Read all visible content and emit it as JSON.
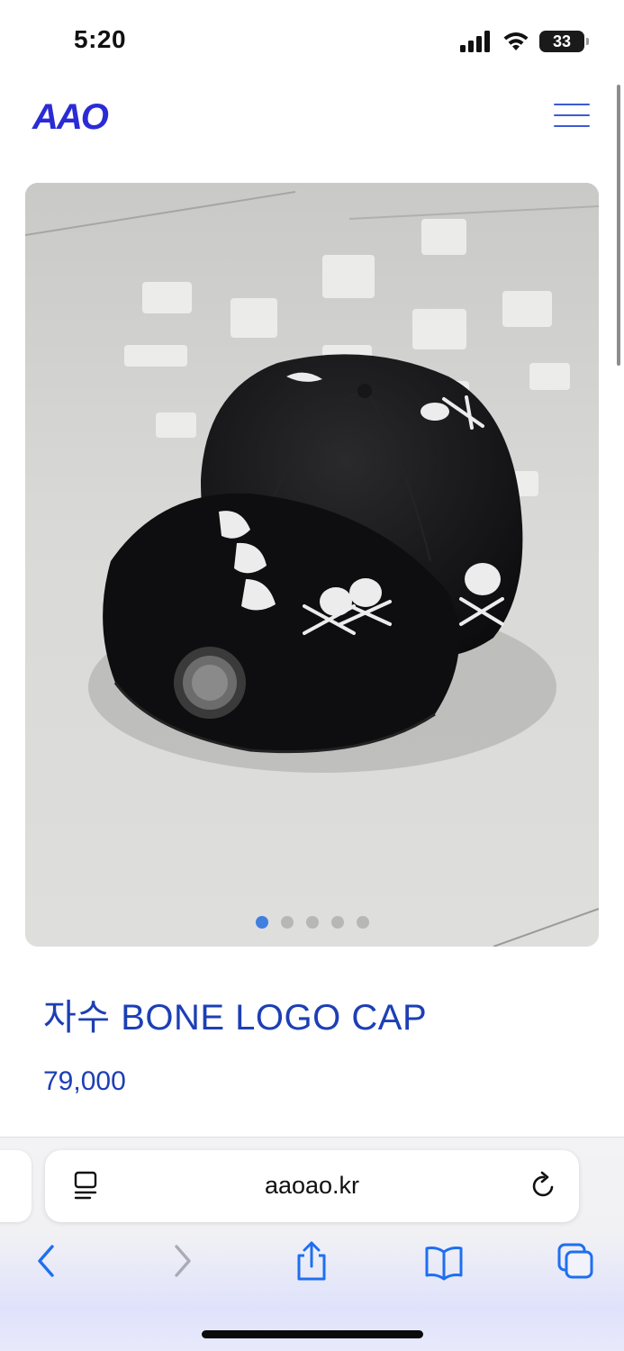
{
  "status_bar": {
    "time": "5:20",
    "battery": "33"
  },
  "header": {
    "logo": "AAO",
    "menu_icon": "hamburger-menu-icon"
  },
  "gallery": {
    "image": "black-snapback-cap-photo",
    "slide_count": 5,
    "active_slide": 1
  },
  "product": {
    "title": "자수 BONE LOGO CAP",
    "price": "79,000"
  },
  "browser": {
    "url": "aaoao.kr",
    "toolbar": [
      "back",
      "forward",
      "share",
      "bookmarks",
      "tabs"
    ]
  },
  "colors": {
    "brand": "#2b2bd6",
    "product_text": "#1d3fb5",
    "active_dot": "#2f74e0",
    "ios_blue": "#1e6ff0"
  }
}
